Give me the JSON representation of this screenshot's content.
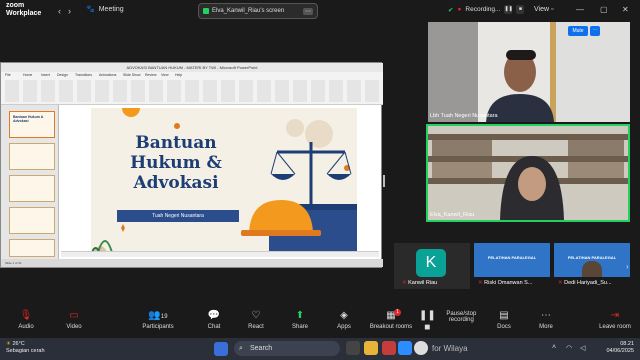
{
  "app": {
    "logo_line1": "zoom",
    "logo_line2": "Workplace"
  },
  "topbar": {
    "meeting_label": "Meeting",
    "screen_share_label": "Elva_Kanwil_Riau's screen",
    "recording_label": "Recording...",
    "view_label": "View"
  },
  "shared_screen": {
    "window_title": "ADVOKASI BANTUAN HUKUM - MATERI BY TWI - Microsoft PowerPoint",
    "ribbon_tabs": [
      "File",
      "Home",
      "Insert",
      "Design",
      "Transitions",
      "Animations",
      "Slide Show",
      "Review",
      "View",
      "Help"
    ],
    "slide": {
      "title_lines": [
        "Bantuan",
        "Hukum &",
        "Advokasi"
      ],
      "subtitle": "Tuah Negeri Nusantara"
    },
    "thumb_title": "Bantuan Hukum & Advokasi",
    "status_text": "Slide 1 of 31"
  },
  "participants_panel": {
    "mute_label": "Mute",
    "video1_name": "Lbh Tuah Negeri Nusantara",
    "video2_name": "Elva_Kanwil_Riau",
    "tiles": [
      {
        "name": "Kanwil Riau",
        "initial": "K"
      },
      {
        "name": "Riski Omanwan S...",
        "banner": "PELATIHAN PARALEGAL"
      },
      {
        "name": "Dedi Hariyadi_Su...",
        "banner": "PELATIHAN PARALEGAL"
      }
    ]
  },
  "toolbar": {
    "audio": "Audio",
    "video": "Video",
    "participants": "Participants",
    "participants_count": "19",
    "chat": "Chat",
    "react": "React",
    "share": "Share",
    "apps": "Apps",
    "breakout": "Breakout rooms",
    "breakout_badge": "1",
    "recording": "Pause/stop recording",
    "docs": "Docs",
    "more": "More",
    "leave": "Leave room"
  },
  "taskbar": {
    "temperature": "26°C",
    "weather": "Sebagian cerah",
    "search_placeholder": "Search",
    "watermark": "for Wilaya",
    "time": "08.21",
    "date": "04/06/2025"
  },
  "colors": {
    "accent": "#0e71eb",
    "share_green": "#23d160",
    "leave_red": "#e02828",
    "slide_title": "#1d3e74"
  }
}
